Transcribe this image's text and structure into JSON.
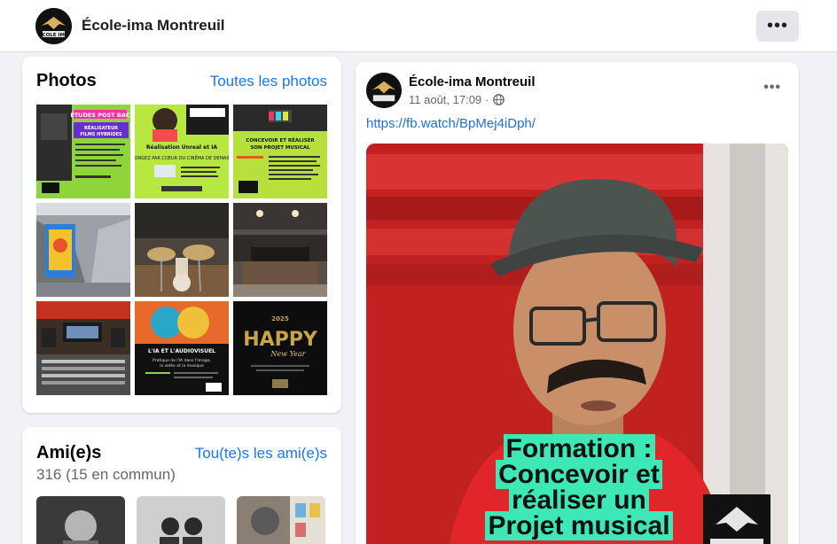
{
  "header": {
    "page_name": "École-ima Montreuil",
    "more_label": "•••"
  },
  "logo": {
    "text": "ÉCOLE IMA"
  },
  "photos": {
    "title": "Photos",
    "see_all": "Toutes les photos",
    "items": [
      {
        "kind": "poster",
        "headline": "ÉTUDES POST BAC",
        "subtitle": "RÉALISATEUR FILMS HYBRIDES",
        "bg": "#8ed43b",
        "accent": "#ff2fa8"
      },
      {
        "kind": "poster",
        "headline": "FORMATION",
        "subtitle": "Réalisation Unreal et IA",
        "bg": "#b6e841",
        "accent": "#1b1b1b"
      },
      {
        "kind": "poster",
        "headline": "FORMATION",
        "subtitle": "CONCEVOIR ET RÉALISER SON PROJET MUSICAL",
        "bg": "#b8e03c",
        "accent": "#1b1b1b"
      },
      {
        "kind": "photo",
        "label": "corridor",
        "bg": "#8a8f94"
      },
      {
        "kind": "photo",
        "label": "drums",
        "bg": "#5a5148"
      },
      {
        "kind": "photo",
        "label": "studio",
        "bg": "#3e3a36"
      },
      {
        "kind": "photo",
        "label": "console",
        "bg": "#3b2e24"
      },
      {
        "kind": "poster",
        "headline": "L'IA ET L'AUDIOVISUEL",
        "subtitle": "Pratique de l'IA dans l'image, la vidéo et la musique",
        "bg": "#101010",
        "accent": "#e85a1c"
      },
      {
        "kind": "poster",
        "headline": "HAPPY",
        "subtitle": "New Year",
        "year": "2025",
        "bg": "#0d0d0d",
        "accent": "#c9a44a"
      }
    ]
  },
  "friends": {
    "title": "Ami(e)s",
    "see_all": "Tou(te)s les ami(e)s",
    "count": "316 (15 en commun)"
  },
  "post": {
    "author": "École-ima Montreuil",
    "date": "11 août, 17:09",
    "separator": "·",
    "more_label": "•••",
    "link": "https://fb.watch/BpMej4iDph/",
    "caption_lines": [
      "Formation :",
      "Concevoir et",
      "réaliser un",
      "Projet musical"
    ]
  },
  "colors": {
    "link": "#1877f2",
    "caption_bg": "#3ee8b6",
    "video_bg": "#c62424"
  }
}
